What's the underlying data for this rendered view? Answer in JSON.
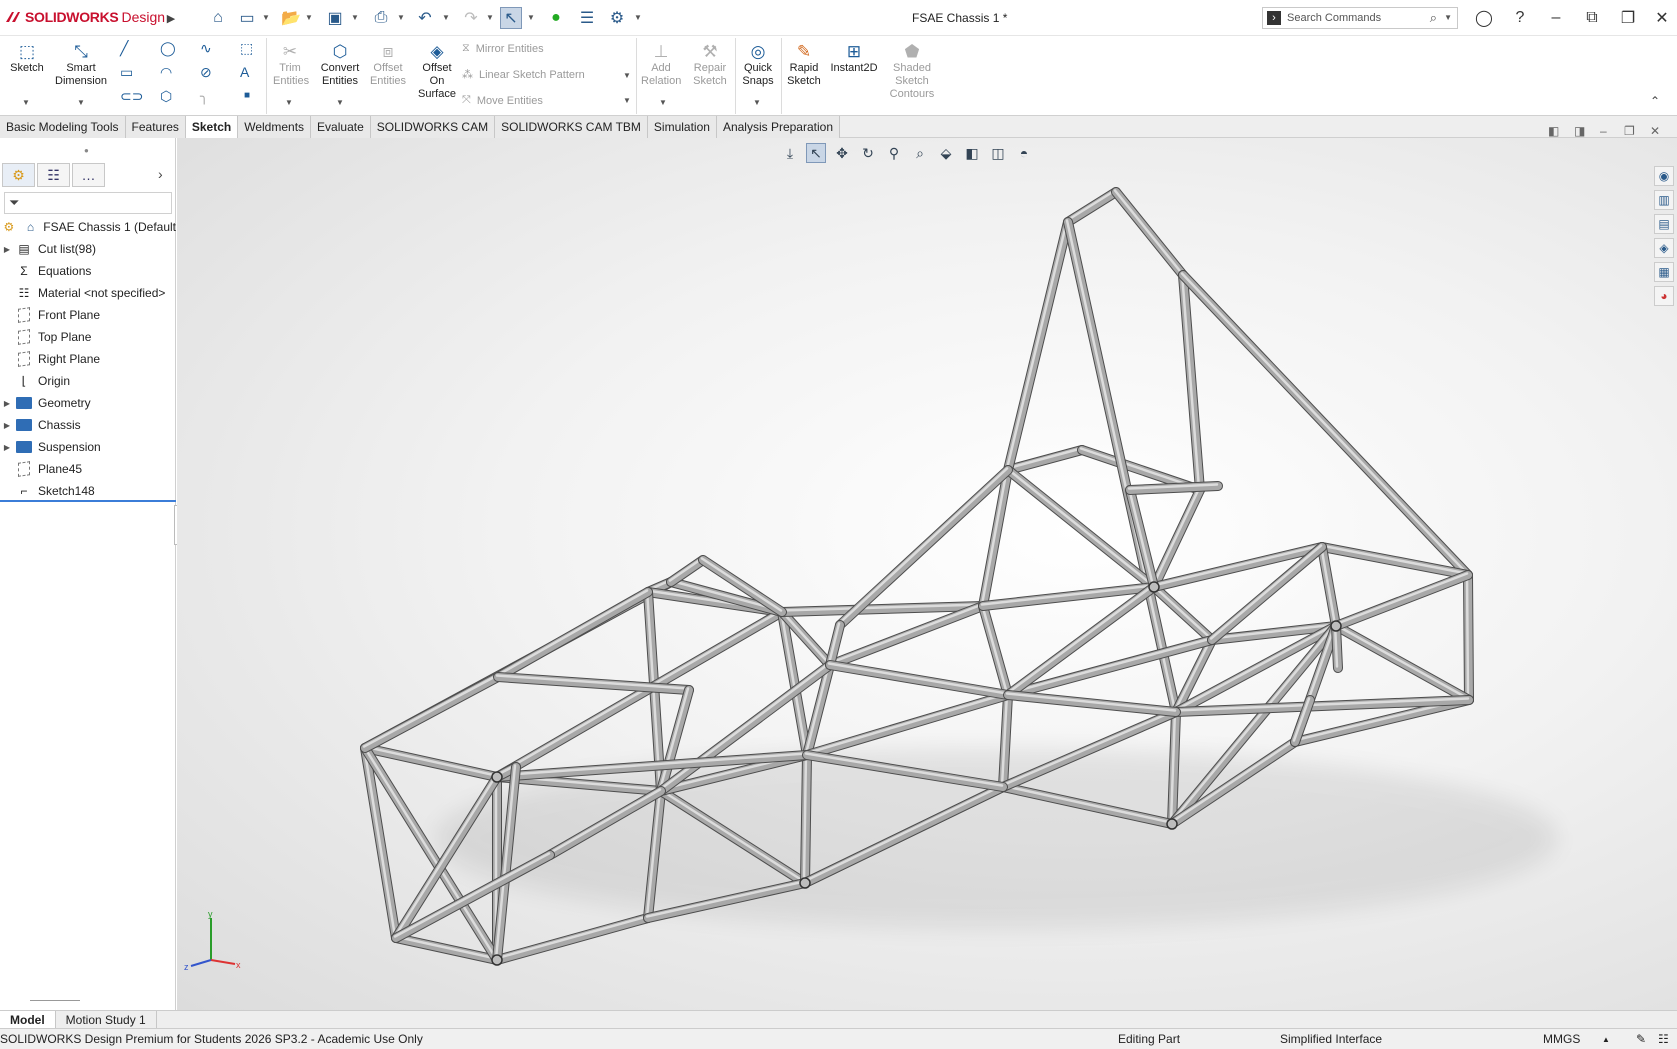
{
  "app": {
    "brand": "SOLIDWORKS",
    "brand_suffix": "Design",
    "document_title": "FSAE Chassis 1 *",
    "search_placeholder": "Search Commands"
  },
  "command_manager": {
    "sketch": "Sketch",
    "smart_dimension": "Smart Dimension",
    "trim_entities": "Trim Entities",
    "convert_entities": "Convert Entities",
    "offset_entities": "Offset Entities",
    "offset_on_surface": "Offset On Surface",
    "mirror_entities": "Mirror Entities",
    "linear_sketch_pattern": "Linear Sketch Pattern",
    "move_entities": "Move Entities",
    "add_relation": "Add Relation",
    "repair_sketch": "Repair Sketch",
    "quick_snaps": "Quick Snaps",
    "rapid_sketch": "Rapid Sketch",
    "instant2d": "Instant2D",
    "shaded_sketch_contours": "Shaded Sketch Contours"
  },
  "tabs": [
    "Basic Modeling Tools",
    "Features",
    "Sketch",
    "Weldments",
    "Evaluate",
    "SOLIDWORKS CAM",
    "SOLIDWORKS CAM TBM",
    "Simulation",
    "Analysis Preparation"
  ],
  "active_tab": "Sketch",
  "feature_tree": {
    "root": "FSAE Chassis 1 (Default",
    "items": [
      "Cut list(98)",
      "Equations",
      "Material <not specified>",
      "Front Plane",
      "Top Plane",
      "Right Plane",
      "Origin",
      "Geometry",
      "Chassis",
      "Suspension",
      "Plane45",
      "Sketch148"
    ]
  },
  "bottom_tabs": [
    "Model",
    "Motion Study 1"
  ],
  "status_bar": {
    "product": "SOLIDWORKS Design Premium for Students 2026 SP3.2 - Academic Use Only",
    "mode": "Editing Part",
    "interface": "Simplified Interface",
    "units": "MMGS"
  },
  "triad": {
    "y": "y",
    "x": "x",
    "z": "z"
  },
  "colors": {
    "brand_red": "#c8102e",
    "accent_blue": "#1d5c98",
    "tube": "#a8a8a8",
    "tube_edge": "#555555"
  }
}
